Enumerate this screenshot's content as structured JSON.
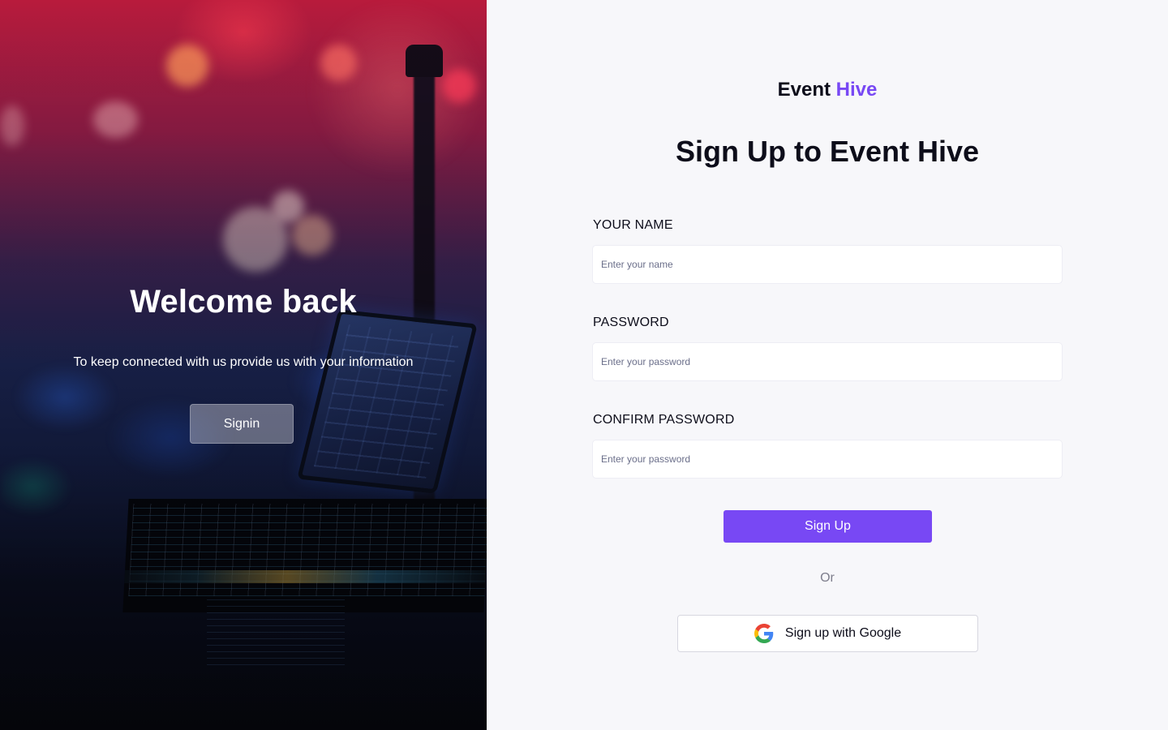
{
  "left_panel": {
    "title": "Welcome back",
    "subtitle": "To keep connected with us provide us with your information",
    "signin_label": "Signin"
  },
  "brand": {
    "part1": "Event",
    "part2": "Hive",
    "accent_color": "#7848F4"
  },
  "form": {
    "heading": "Sign Up to Event Hive",
    "name": {
      "label": "YOUR NAME",
      "placeholder": "Enter your name",
      "value": ""
    },
    "password": {
      "label": "PASSWORD",
      "placeholder": "Enter your password",
      "value": ""
    },
    "confirm_password": {
      "label": "CONFIRM PASSWORD",
      "placeholder": "Enter your password",
      "value": ""
    },
    "submit_label": "Sign Up",
    "divider": "Or",
    "google_label": "Sign up with Google",
    "google_icon": "google-g-icon"
  },
  "colors": {
    "primary": "#7848F4",
    "panel_bg": "#F7F7FA",
    "text": "#0D0D1A"
  }
}
